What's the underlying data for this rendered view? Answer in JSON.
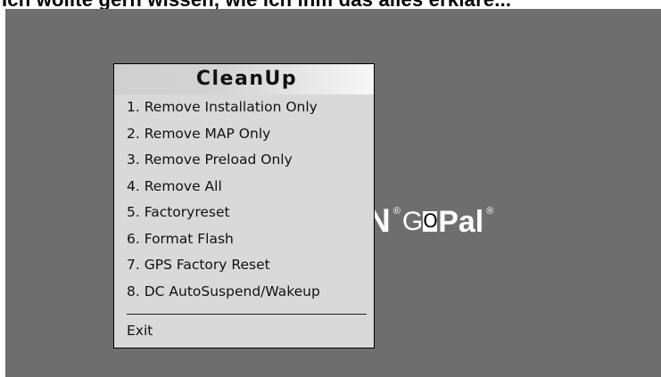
{
  "header": {
    "partial_text": "Ich wollte gern wissen, wie ich ihm das alles erkläre..."
  },
  "logo": {
    "partial": "N",
    "registered_mark": "®",
    "go": "G",
    "o_boxed": "O",
    "pal": "Pal",
    "registered_mark_2": "®"
  },
  "menu": {
    "title": "CleanUp",
    "items": [
      {
        "label": "1. Remove Installation Only"
      },
      {
        "label": "2. Remove MAP Only"
      },
      {
        "label": "3. Remove Preload Only"
      },
      {
        "label": "4. Remove All"
      },
      {
        "label": "5. Factoryreset"
      },
      {
        "label": "6. Format Flash"
      },
      {
        "label": "7. GPS Factory Reset"
      },
      {
        "label": "8. DC AutoSuspend/Wakeup"
      }
    ],
    "exit": "Exit"
  },
  "colors": {
    "screen_bg": "#6e6e6e",
    "menu_bg": "#d9d9d9",
    "title_gradient_end": "#f7f7f7"
  }
}
